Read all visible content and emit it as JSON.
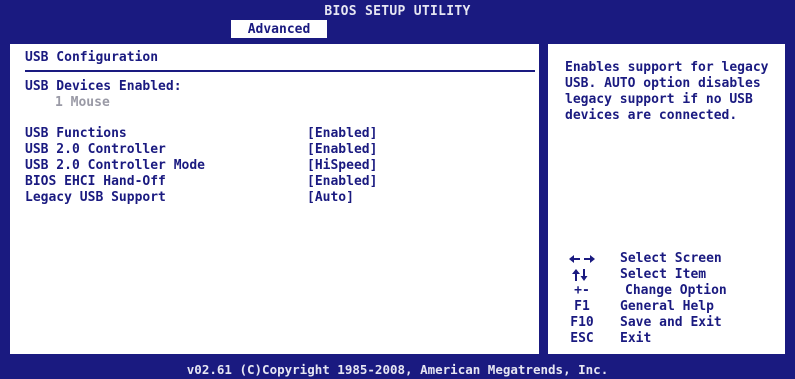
{
  "header": {
    "title": "BIOS SETUP UTILITY",
    "active_tab": "Advanced"
  },
  "main": {
    "section_title": "USB Configuration",
    "devices_label": "USB Devices Enabled:",
    "devices_value": "1 Mouse",
    "options": [
      {
        "label": "USB Functions",
        "value": "[Enabled]"
      },
      {
        "label": "USB 2.0 Controller",
        "value": "[Enabled]"
      },
      {
        "label": "USB 2.0 Controller Mode",
        "value": "[HiSpeed]"
      },
      {
        "label": "BIOS EHCI Hand-Off",
        "value": "[Enabled]"
      },
      {
        "label": "Legacy USB Support",
        "value": "[Auto]"
      }
    ]
  },
  "help": {
    "text": "Enables support for legacy USB. AUTO option disables legacy support if no USB devices are connected."
  },
  "keys": [
    {
      "key": "",
      "icon": "left-right-arrows-icon",
      "desc": "Select Screen"
    },
    {
      "key": "",
      "icon": "up-down-arrows-icon",
      "desc": "Select Item"
    },
    {
      "key": "+-",
      "desc": "Change Option"
    },
    {
      "key": "F1",
      "desc": "General Help"
    },
    {
      "key": "F10",
      "desc": "Save and Exit"
    },
    {
      "key": "ESC",
      "desc": "Exit"
    }
  ],
  "footer": {
    "copyright": "v02.61 (C)Copyright 1985-2008, American Megatrends, Inc."
  },
  "colors": {
    "frame": "#1a1a80",
    "text": "#1a1a80",
    "disabled_text": "#9a9aa6",
    "background": "#ffffff"
  }
}
